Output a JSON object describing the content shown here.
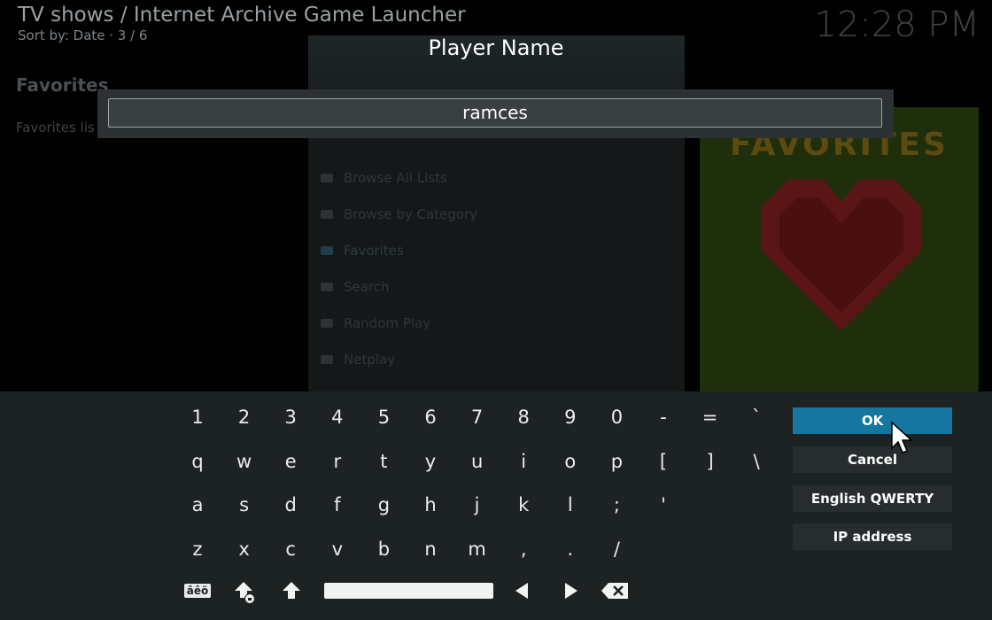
{
  "background": {
    "header_title": "TV shows / Internet Archive Game Launcher",
    "header_sort": "Sort by: Date  ·  3 / 6",
    "clock": "12:28 PM",
    "side_title": "Favorites",
    "side_text": "Favorites lis",
    "list_items": [
      {
        "label": "Browse All Lists",
        "active": false
      },
      {
        "label": "Browse by Category",
        "active": false
      },
      {
        "label": "Favorites",
        "active": true
      },
      {
        "label": "Search",
        "active": false
      },
      {
        "label": "Random Play",
        "active": false
      },
      {
        "label": "Netplay",
        "active": false
      }
    ],
    "poster_title": "FAVORITES"
  },
  "dialog": {
    "title": "Player Name",
    "input_value": "ramces"
  },
  "keyboard": {
    "rows": [
      [
        "1",
        "2",
        "3",
        "4",
        "5",
        "6",
        "7",
        "8",
        "9",
        "0",
        "-",
        "=",
        "`"
      ],
      [
        "q",
        "w",
        "e",
        "r",
        "t",
        "y",
        "u",
        "i",
        "o",
        "p",
        "[",
        "]",
        "\\"
      ],
      [
        "a",
        "s",
        "d",
        "f",
        "g",
        "h",
        "j",
        "k",
        "l",
        ";",
        "'"
      ],
      [
        "z",
        "x",
        "c",
        "v",
        "b",
        "n",
        "m",
        ",",
        ".",
        "/"
      ]
    ],
    "symbols_key": "âêö"
  },
  "buttons": {
    "ok": "OK",
    "cancel": "Cancel",
    "layout": "English QWERTY",
    "ip_address": "IP address"
  },
  "colors": {
    "accent": "#1576a0",
    "panel": "#1d2223"
  }
}
